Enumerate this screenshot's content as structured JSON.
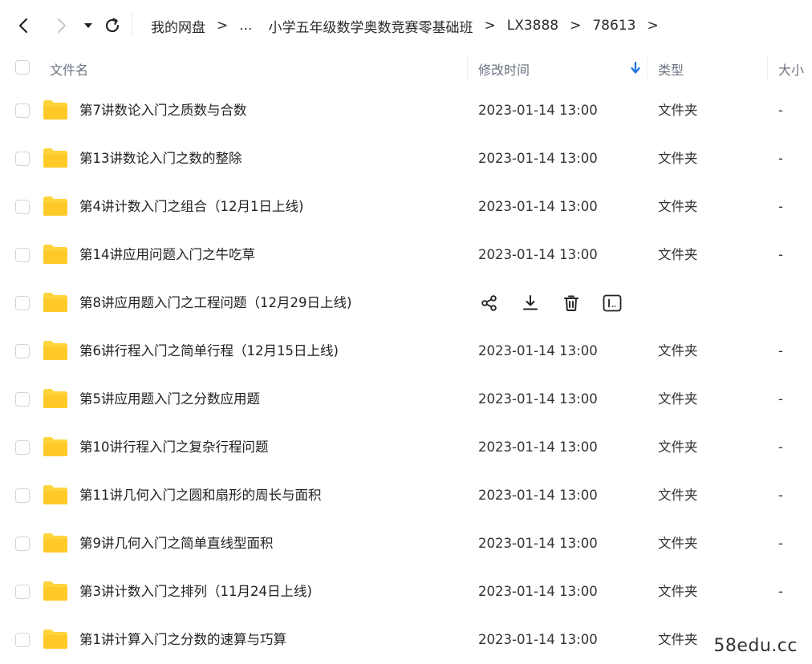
{
  "breadcrumb": {
    "items": [
      {
        "label": "我的网盘"
      },
      {
        "label": "..."
      },
      {
        "label": "小学五年级数学奥数竞赛零基础班"
      },
      {
        "label": "LX3888"
      },
      {
        "label": "78613"
      }
    ],
    "separator": ">"
  },
  "columns": {
    "name": "文件名",
    "modified": "修改时间",
    "type": "类型",
    "size": "大小"
  },
  "rows": [
    {
      "name": "第7讲数论入门之质数与合数",
      "modified": "2023-01-14 13:00",
      "type": "文件夹",
      "size": "-"
    },
    {
      "name": "第13讲数论入门之数的整除",
      "modified": "2023-01-14 13:00",
      "type": "文件夹",
      "size": "-"
    },
    {
      "name": "第4讲计数入门之组合（12月1日上线)",
      "modified": "2023-01-14 13:00",
      "type": "文件夹",
      "size": "-"
    },
    {
      "name": "第14讲应用问题入门之牛吃草",
      "modified": "2023-01-14 13:00",
      "type": "文件夹",
      "size": "-"
    },
    {
      "name": "第8讲应用题入门之工程问题（12月29日上线)",
      "modified": "",
      "type": "",
      "size": "",
      "hovered": true
    },
    {
      "name": "第6讲行程入门之简单行程（12月15日上线)",
      "modified": "2023-01-14 13:00",
      "type": "文件夹",
      "size": "-"
    },
    {
      "name": "第5讲应用题入门之分数应用题",
      "modified": "2023-01-14 13:00",
      "type": "文件夹",
      "size": "-"
    },
    {
      "name": "第10讲行程入门之复杂行程问题",
      "modified": "2023-01-14 13:00",
      "type": "文件夹",
      "size": "-"
    },
    {
      "name": "第11讲几何入门之圆和扇形的周长与面积",
      "modified": "2023-01-14 13:00",
      "type": "文件夹",
      "size": "-"
    },
    {
      "name": "第9讲几何入门之简单直线型面积",
      "modified": "2023-01-14 13:00",
      "type": "文件夹",
      "size": "-"
    },
    {
      "name": "第3讲计数入门之排列（11月24日上线)",
      "modified": "2023-01-14 13:00",
      "type": "文件夹",
      "size": "-"
    },
    {
      "name": "第1讲计算入门之分数的速算与巧算",
      "modified": "2023-01-14 13:00",
      "type": "文件夹",
      "size": "-"
    }
  ],
  "hover_actions": [
    "share-icon",
    "download-icon",
    "delete-icon",
    "rename-icon"
  ],
  "icons": {
    "back": "chevron-left-icon",
    "forward": "chevron-right-icon",
    "dropdown": "caret-down-icon",
    "refresh": "refresh-icon",
    "folder": "folder-icon",
    "sort": "arrow-down-icon"
  },
  "colors": {
    "folder": "#FFD43B",
    "sort_arrow": "#1a73e8",
    "text": "#222222"
  },
  "watermark": "58edu.cc"
}
